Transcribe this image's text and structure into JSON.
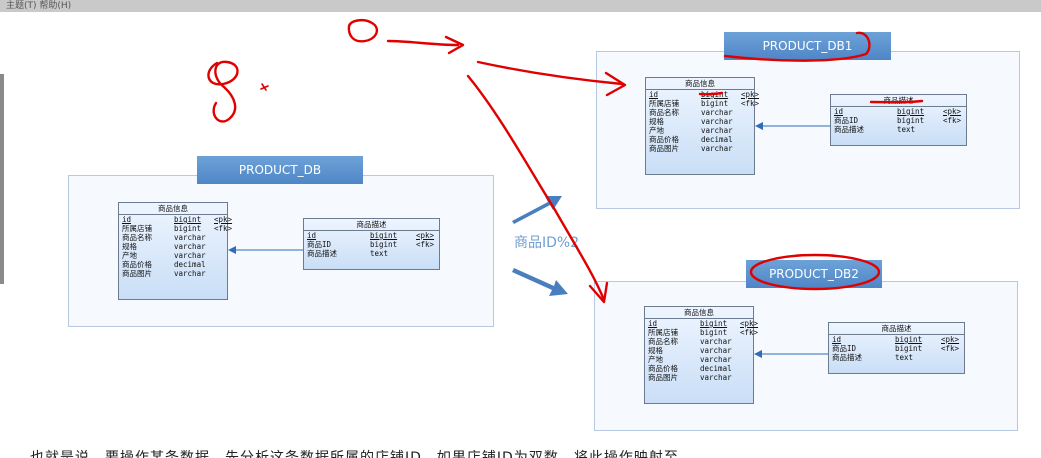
{
  "topbar_text": "主题(T)  帮助(H)",
  "annotation_label": "商品ID%2",
  "caption": "也就是说，要操作某条数据，先分析这条数据所属的店铺ID，如果店铺ID为双数，将此操作映射至",
  "colors": {
    "panel_border": "#b7c9e2",
    "db_title_bg": "#5b8fcd",
    "arrow": "#4a7fbf",
    "ink": "#e00000"
  },
  "source_db": {
    "title": "PRODUCT_DB",
    "info": {
      "header": "商品信息",
      "rows": [
        {
          "name": "id",
          "type": "bigint",
          "key": "<pk>",
          "underline": true
        },
        {
          "name": "所属店铺",
          "type": "bigint",
          "key": "<fk>",
          "underline": false
        },
        {
          "name": "商品名称",
          "type": "varchar",
          "key": "",
          "underline": false
        },
        {
          "name": "规格",
          "type": "varchar",
          "key": "",
          "underline": false
        },
        {
          "name": "产地",
          "type": "varchar",
          "key": "",
          "underline": false
        },
        {
          "name": "商品价格",
          "type": "decimal",
          "key": "",
          "underline": false
        },
        {
          "name": "商品图片",
          "type": "varchar",
          "key": "",
          "underline": false
        }
      ]
    },
    "desc": {
      "header": "商品描述",
      "rows": [
        {
          "name": "id",
          "type": "bigint",
          "key": "<pk>",
          "underline": true
        },
        {
          "name": "商品ID",
          "type": "bigint",
          "key": "<fk>",
          "underline": false
        },
        {
          "name": "商品描述",
          "type": "text",
          "key": "",
          "underline": false
        }
      ]
    }
  },
  "db1": {
    "title": "PRODUCT_DB1",
    "info": {
      "header": "商品信息",
      "rows": [
        {
          "name": "id",
          "type": "bigint",
          "key": "<pk>",
          "underline": true
        },
        {
          "name": "所属店铺",
          "type": "bigint",
          "key": "<fk>",
          "underline": false
        },
        {
          "name": "商品名称",
          "type": "varchar",
          "key": "",
          "underline": false
        },
        {
          "name": "规格",
          "type": "varchar",
          "key": "",
          "underline": false
        },
        {
          "name": "产地",
          "type": "varchar",
          "key": "",
          "underline": false
        },
        {
          "name": "商品价格",
          "type": "decimal",
          "key": "",
          "underline": false
        },
        {
          "name": "商品图片",
          "type": "varchar",
          "key": "",
          "underline": false
        }
      ]
    },
    "desc": {
      "header": "商品描述",
      "rows": [
        {
          "name": "id",
          "type": "bigint",
          "key": "<pk>",
          "underline": true
        },
        {
          "name": "商品ID",
          "type": "bigint",
          "key": "<fk>",
          "underline": false
        },
        {
          "name": "商品描述",
          "type": "text",
          "key": "",
          "underline": false
        }
      ]
    }
  },
  "db2": {
    "title": "PRODUCT_DB2",
    "info": {
      "header": "商品信息",
      "rows": [
        {
          "name": "id",
          "type": "bigint",
          "key": "<pk>",
          "underline": true
        },
        {
          "name": "所属店铺",
          "type": "bigint",
          "key": "<fk>",
          "underline": false
        },
        {
          "name": "商品名称",
          "type": "varchar",
          "key": "",
          "underline": false
        },
        {
          "name": "规格",
          "type": "varchar",
          "key": "",
          "underline": false
        },
        {
          "name": "产地",
          "type": "varchar",
          "key": "",
          "underline": false
        },
        {
          "name": "商品价格",
          "type": "decimal",
          "key": "",
          "underline": false
        },
        {
          "name": "商品图片",
          "type": "varchar",
          "key": "",
          "underline": false
        }
      ]
    },
    "desc": {
      "header": "商品描述",
      "rows": [
        {
          "name": "id",
          "type": "bigint",
          "key": "<pk>",
          "underline": true
        },
        {
          "name": "商品ID",
          "type": "bigint",
          "key": "<fk>",
          "underline": false
        },
        {
          "name": "商品描述",
          "type": "text",
          "key": "",
          "underline": false
        }
      ]
    }
  }
}
